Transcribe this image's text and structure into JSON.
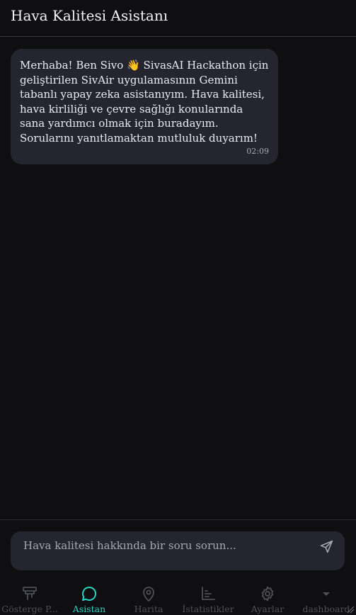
{
  "header": {
    "title": "Hava Kalitesi Asistanı"
  },
  "messages": [
    {
      "sender": "assistant",
      "text": "Merhaba! Ben Sivo 👋 SivasAI Hackathon için geliştirilen SivAir uygulamasının Gemini tabanlı yapay zeka asistanıyım. Hava kalitesi, hava kirliliği ve çevre sağlığı konularında sana yardımcı olmak için buradayım. Sorularını yanıtlamaktan mutluluk duyarım!",
      "time": "02:09"
    }
  ],
  "composer": {
    "placeholder": "Hava kalitesi hakkında bir soru sorun...",
    "value": ""
  },
  "tabs": [
    {
      "label": "Gösterge P...",
      "icon": "gauge-icon",
      "active": false
    },
    {
      "label": "Asistan",
      "icon": "chat-bubble-icon",
      "active": true
    },
    {
      "label": "Harita",
      "icon": "map-pin-icon",
      "active": false
    },
    {
      "label": "İstatistikler",
      "icon": "bar-chart-icon",
      "active": false
    },
    {
      "label": "Ayarlar",
      "icon": "gear-icon",
      "active": false
    },
    {
      "label": "dashboard",
      "icon": "caret-down-icon",
      "active": false
    }
  ],
  "colors": {
    "accent": "#2ad4c4",
    "background": "#0f0f11",
    "surface": "#25252f",
    "inactive": "#4f4f58"
  }
}
